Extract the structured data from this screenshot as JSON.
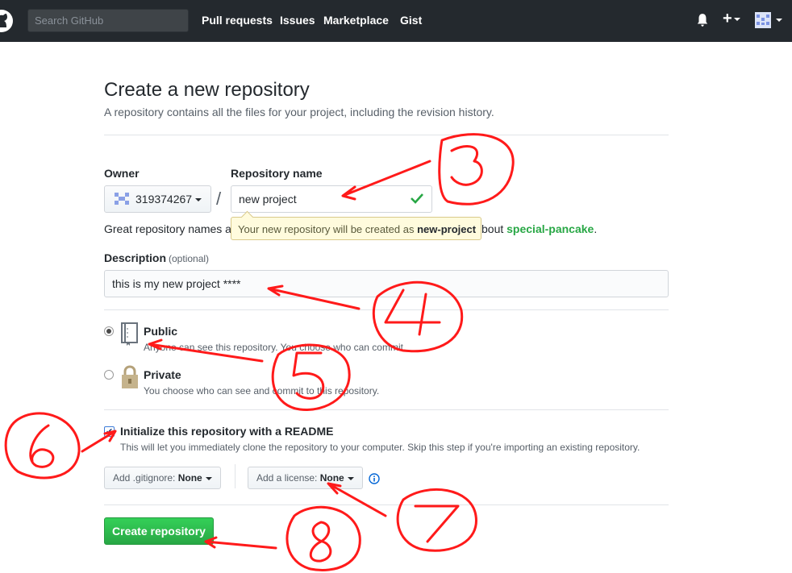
{
  "header": {
    "search_placeholder": "Search GitHub",
    "nav": [
      "Pull requests",
      "Issues",
      "Marketplace",
      "Gist"
    ],
    "plus_label": "+"
  },
  "page": {
    "title": "Create a new repository",
    "subtitle": "A repository contains all the files for your project, including the revision history."
  },
  "form": {
    "owner_label": "Owner",
    "owner_value": "319374267",
    "slash": "/",
    "repo_label": "Repository name",
    "repo_value": "new project",
    "hint_start": "Great repository names a",
    "hint_end": "bout ",
    "hint_suggestion": "special-pancake",
    "hint_period": ".",
    "tooltip_text": "Your new repository will be created as ",
    "tooltip_name": "new-project",
    "description_label": "Description",
    "description_optional": "(optional)",
    "description_value": "this is my new project ****",
    "visibility": [
      {
        "title": "Public",
        "note": "Anyone can see this repository. You choose who can commit.",
        "selected": true
      },
      {
        "title": "Private",
        "note": "You choose who can see and commit to this repository.",
        "selected": false
      }
    ],
    "readme_label": "Initialize this repository with a README",
    "readme_note": "This will let you immediately clone the repository to your computer. Skip this step if you're importing an existing repository.",
    "readme_checked": true,
    "gitignore_label": "Add .gitignore:",
    "gitignore_value": "None",
    "license_label": "Add a license:",
    "license_value": "None",
    "submit_label": "Create repository"
  },
  "annotations": [
    "3",
    "4",
    "5",
    "6",
    "7",
    "8"
  ],
  "colors": {
    "header_bg": "#24292e",
    "primary_button": "#28a745",
    "annotation_red": "#ff1a1a",
    "tooltip_bg": "#fffbdd"
  }
}
